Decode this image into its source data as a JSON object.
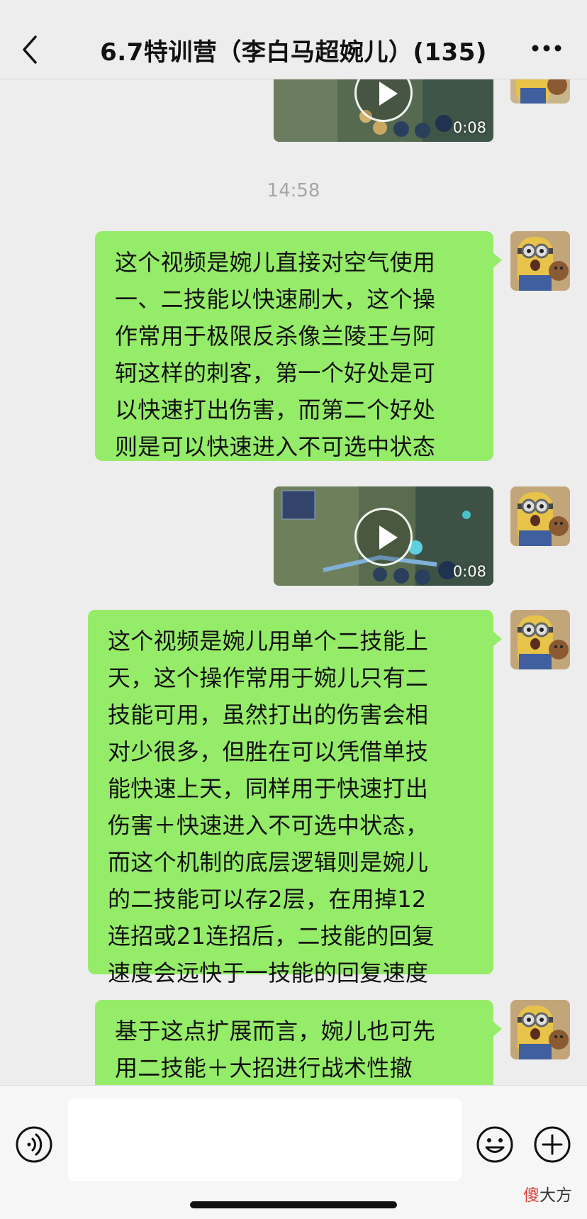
{
  "header": {
    "title": "6.7特训营（李白马超婉儿）(135)",
    "back_icon": "chevron-left-icon",
    "more_icon": "more-dots-icon"
  },
  "chat": {
    "timestamp": "14:58",
    "messages": [
      {
        "type": "video",
        "duration": "0:08"
      },
      {
        "type": "text",
        "text": "这个视频是婉儿直接对空气使用\n一、二技能以快速刷大，这个操\n作常用于极限反杀像兰陵王与阿\n轲这样的刺客，第一个好处是可\n以快速打出伤害，而第二个好处\n则是可以快速进入不可选中状态"
      },
      {
        "type": "video",
        "duration": "0:08"
      },
      {
        "type": "text",
        "text": "这个视频是婉儿用单个二技能上\n天，这个操作常用于婉儿只有二\n技能可用，虽然打出的伤害会相\n对少很多，但胜在可以凭借单技\n能快速上天，同样用于快速打出\n伤害＋快速进入不可选中状态，\n而这个机制的底层逻辑则是婉儿\n的二技能可以存2层，在用掉12\n连招或21连招后，二技能的回复\n速度会远快于一技能的回复速度"
      },
      {
        "type": "text",
        "text": "基于这点扩展而言，婉儿也可先\n用二技能＋大招进行战术性撤\n退"
      }
    ]
  },
  "input_bar": {
    "voice_icon": "voice-icon",
    "emoji_icon": "emoji-icon",
    "plus_icon": "plus-icon",
    "text_value": ""
  },
  "watermark": {
    "part1": "傻",
    "part2": "大方"
  },
  "colors": {
    "bubble": "#95ec69",
    "background": "#ededed",
    "timestamp": "#a6a6a6"
  }
}
